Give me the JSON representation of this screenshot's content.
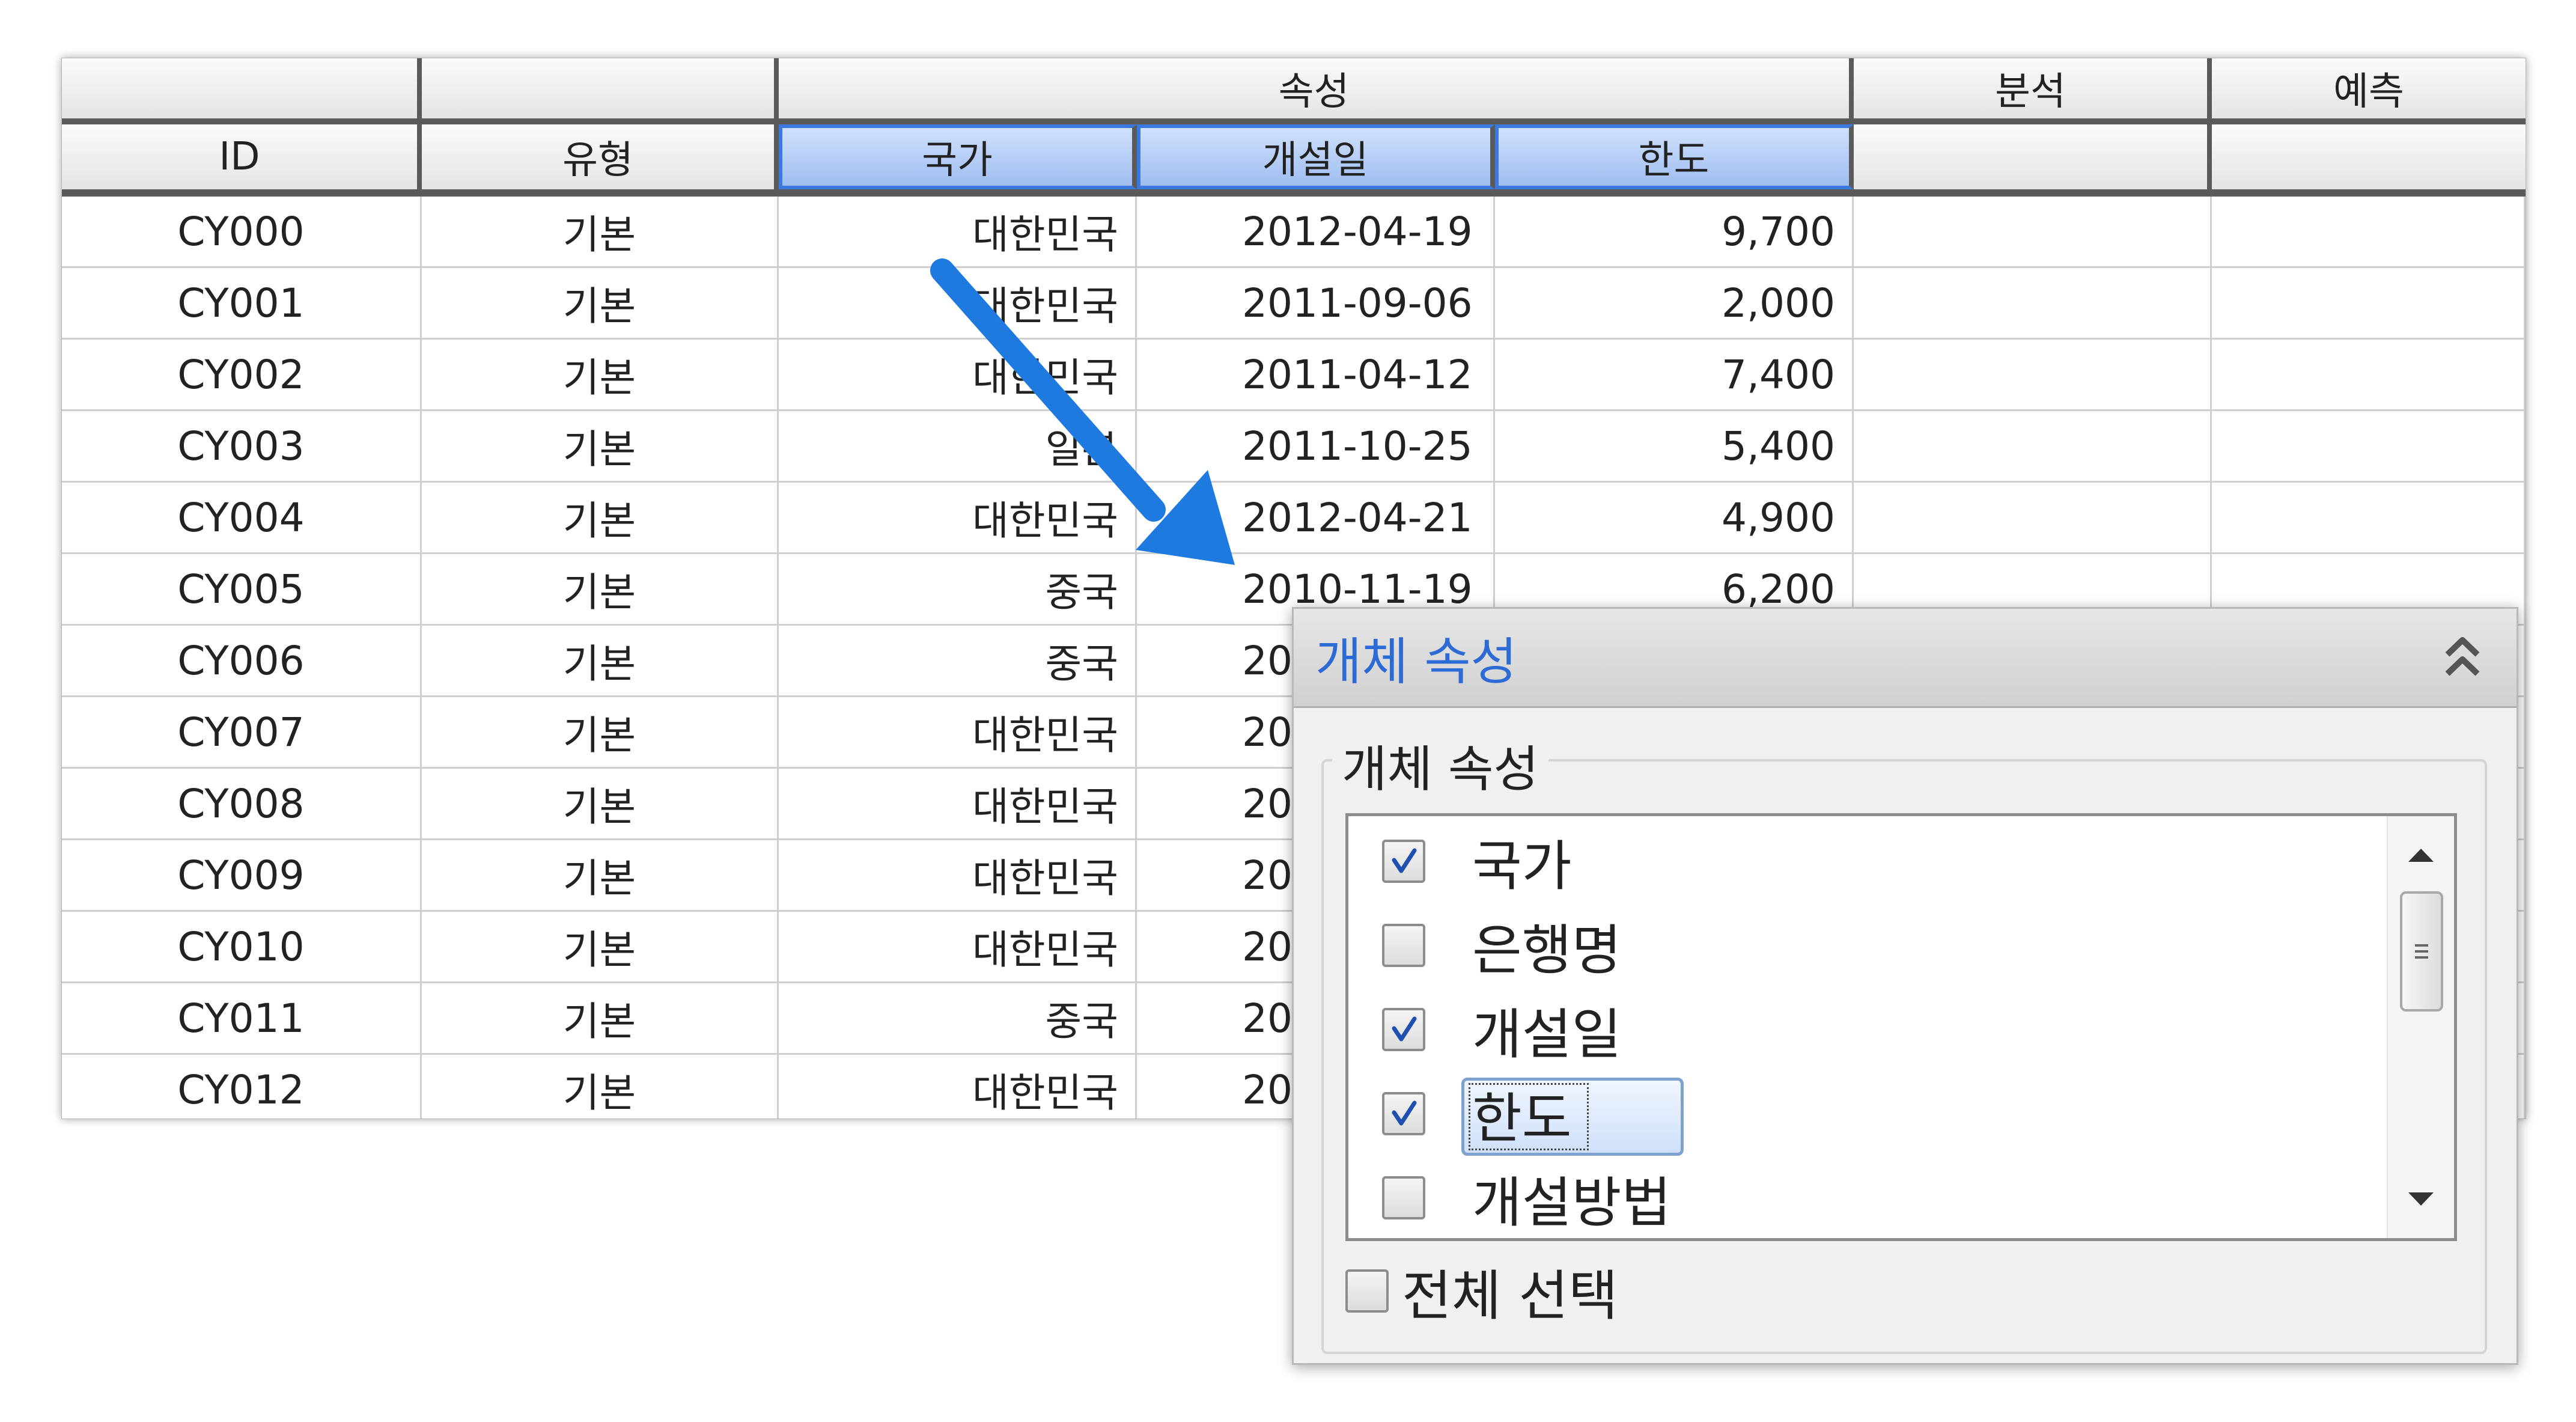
{
  "grid": {
    "group_headers": {
      "attributes": "속성",
      "analysis": "분석",
      "prediction": "예측"
    },
    "columns": [
      "ID",
      "유형",
      "국가",
      "개설일",
      "한도",
      "",
      ""
    ],
    "selected_columns": [
      "국가",
      "개설일",
      "한도"
    ],
    "rows": [
      {
        "id": "CY000",
        "type": "기본",
        "country": "대한민국",
        "date": "2012-04-19",
        "limit": "9,700"
      },
      {
        "id": "CY001",
        "type": "기본",
        "country": "대한민국",
        "date": "2011-09-06",
        "limit": "2,000"
      },
      {
        "id": "CY002",
        "type": "기본",
        "country": "대한민국",
        "date": "2011-04-12",
        "limit": "7,400"
      },
      {
        "id": "CY003",
        "type": "기본",
        "country": "일본",
        "date": "2011-10-25",
        "limit": "5,400"
      },
      {
        "id": "CY004",
        "type": "기본",
        "country": "대한민국",
        "date": "2012-04-21",
        "limit": "4,900"
      },
      {
        "id": "CY005",
        "type": "기본",
        "country": "중국",
        "date": "2010-11-19",
        "limit": "6,200"
      },
      {
        "id": "CY006",
        "type": "기본",
        "country": "중국",
        "date": "20",
        "limit": ""
      },
      {
        "id": "CY007",
        "type": "기본",
        "country": "대한민국",
        "date": "20",
        "limit": ""
      },
      {
        "id": "CY008",
        "type": "기본",
        "country": "대한민국",
        "date": "20",
        "limit": ""
      },
      {
        "id": "CY009",
        "type": "기본",
        "country": "대한민국",
        "date": "20",
        "limit": ""
      },
      {
        "id": "CY010",
        "type": "기본",
        "country": "대한민국",
        "date": "20",
        "limit": ""
      },
      {
        "id": "CY011",
        "type": "기본",
        "country": "중국",
        "date": "20",
        "limit": ""
      },
      {
        "id": "CY012",
        "type": "기본",
        "country": "대한민국",
        "date": "20",
        "limit": ""
      }
    ]
  },
  "panel": {
    "title": "개체 속성",
    "group_label": "개체 속성",
    "items": [
      {
        "label": "국가",
        "checked": true
      },
      {
        "label": "은행명",
        "checked": false
      },
      {
        "label": "개설일",
        "checked": true
      },
      {
        "label": "한도",
        "checked": true,
        "focused": true
      },
      {
        "label": "개설방법",
        "checked": false
      }
    ],
    "select_all_label": "전체 선택",
    "select_all_checked": false
  },
  "colors": {
    "accent": "#3b78e0",
    "arrow": "#1f7ae0",
    "panel_title": "#2c6bd6",
    "selected_header": "#9fbdf0"
  }
}
